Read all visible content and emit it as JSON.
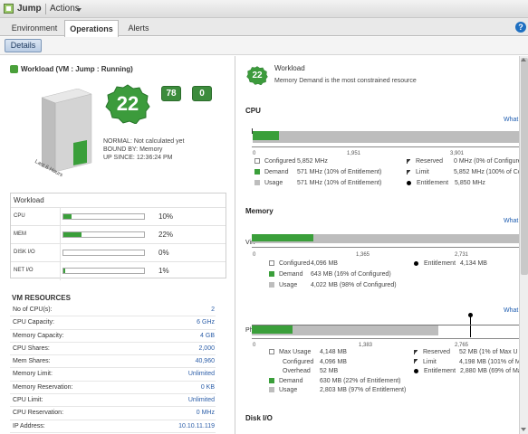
{
  "header": {
    "title": "Jump",
    "actions": "Actions"
  },
  "tabs": [
    "Environment",
    "Operations",
    "Alerts"
  ],
  "active_tab": "Operations",
  "help_icon": "?",
  "subtab": {
    "details": "Details"
  },
  "left": {
    "workload_header": "Workload (VM : Jump : Running)",
    "last_hours": "Last 6 Hours",
    "badge_main": "22",
    "badge_small_1": "78",
    "badge_small_2": "0",
    "info": [
      "NORMAL: Not calculated yet",
      "BOUND BY: Memory",
      "UP SINCE: 12:36:24 PM"
    ],
    "workload_box": {
      "title": "Workload",
      "rows": [
        {
          "label": "CPU",
          "pct": "10%",
          "value": 0.1
        },
        {
          "label": "MEM",
          "pct": "22%",
          "value": 0.22
        },
        {
          "label": "DISK I/O",
          "pct": "0%",
          "value": 0.0
        },
        {
          "label": "NET I/O",
          "pct": "1%",
          "value": 0.01
        }
      ]
    },
    "vm_resources": {
      "title": "VM RESOURCES",
      "rows": [
        {
          "k": "No of CPU(s):",
          "v": "2"
        },
        {
          "k": "CPU Capacity:",
          "v": "6 GHz"
        },
        {
          "k": "Memory Capacity:",
          "v": "4 GB"
        },
        {
          "k": "CPU Shares:",
          "v": "2,000"
        },
        {
          "k": "Mem Shares:",
          "v": "40,960"
        },
        {
          "k": "Memory Limit:",
          "v": "Unlimited"
        },
        {
          "k": "Memory Reservation:",
          "v": "0 KB"
        },
        {
          "k": "CPU Limit:",
          "v": "Unlimited"
        },
        {
          "k": "CPU Reservation:",
          "v": "0 MHz"
        },
        {
          "k": "IP Address:",
          "v": "10.10.11.119"
        }
      ]
    }
  },
  "right": {
    "badge": "22",
    "title": "Workload",
    "subtitle": "Memory Demand is the most constrained resource",
    "what": "What",
    "cpu": {
      "title": "CPU",
      "ticks": [
        "0",
        "1,951",
        "3,901"
      ],
      "legend_left": [
        {
          "type": "empty",
          "label": "Configured",
          "value": "5,852 MHz"
        },
        {
          "type": "green",
          "label": "Demand",
          "value": "571 MHz (10% of Entitlement)"
        },
        {
          "type": "gray",
          "label": "Usage",
          "value": "571 MHz (10% of Entitlement)"
        }
      ],
      "legend_right": [
        {
          "type": "flag",
          "label": "Reserved",
          "value": "0 MHz (0% of Configure"
        },
        {
          "type": "flag",
          "label": "Limit",
          "value": "5,852 MHz (100% of Co"
        },
        {
          "type": "dot",
          "label": "Entitlement",
          "value": "5,850 MHz"
        }
      ]
    },
    "memory": {
      "title": "Memory",
      "virt": {
        "label": "Virt",
        "ticks": [
          "0",
          "1,365",
          "2,731"
        ],
        "legend_left": [
          {
            "type": "empty",
            "label": "Configured",
            "value": "4,096 MB"
          },
          {
            "type": "green",
            "label": "Demand",
            "value": "643 MB (16% of Configured)"
          },
          {
            "type": "gray",
            "label": "Usage",
            "value": "4,022 MB (98% of Configured)"
          }
        ],
        "legend_right": [
          {
            "type": "dot",
            "label": "Entitlement",
            "value": "4,134 MB"
          }
        ]
      },
      "phys": {
        "label": "Phys",
        "ticks": [
          "0",
          "1,383",
          "2,765"
        ],
        "legend_left": [
          {
            "type": "empty",
            "label": "Max Usage",
            "value": "4,148 MB"
          },
          {
            "type": "none",
            "label": "Configured",
            "value": "4,096 MB"
          },
          {
            "type": "none",
            "label": "Overhead",
            "value": "52 MB"
          },
          {
            "type": "green",
            "label": "Demand",
            "value": "630 MB (22% of Entitlement)"
          },
          {
            "type": "gray",
            "label": "Usage",
            "value": "2,803 MB (97% of Entitlement)"
          }
        ],
        "legend_right": [
          {
            "type": "flag",
            "label": "Reserved",
            "value": "52 MB (1% of Max U"
          },
          {
            "type": "flag",
            "label": "Limit",
            "value": "4,198 MB (101% of M"
          },
          {
            "type": "dot",
            "label": "Entitlement",
            "value": "2,880 MB (69% of Ma"
          }
        ]
      }
    },
    "disk": {
      "title": "Disk I/O"
    }
  },
  "colors": {
    "green": "#3a9f3a",
    "gray": "#bdbdbd",
    "link": "#2c5ea8"
  }
}
